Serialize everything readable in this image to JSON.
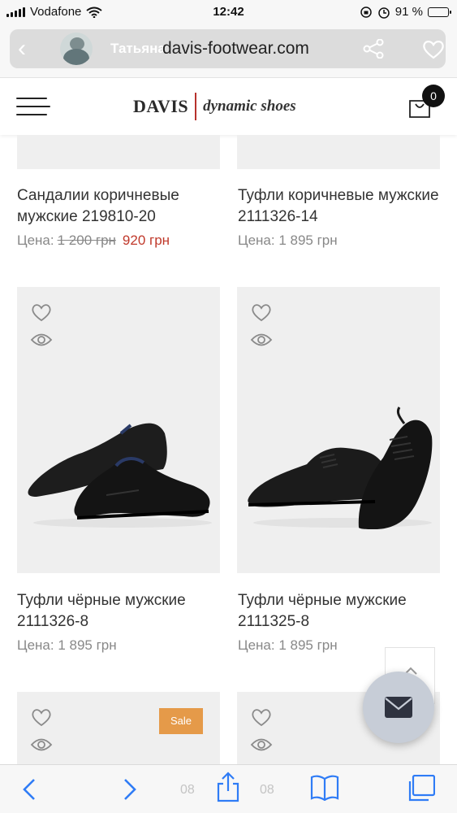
{
  "status_bar": {
    "carrier": "Vodafone",
    "time": "12:42",
    "battery": "91 %",
    "battery_level": 0.91
  },
  "browser": {
    "user_name": "Татьяна",
    "url": "davis-footwear.com"
  },
  "site": {
    "brand": "DAVIS",
    "tagline": "dynamic shoes",
    "cart_count": "0"
  },
  "products": [
    {
      "name": "Сандалии коричневые мужские 219810-20",
      "price_label": "Цена:",
      "old_price": "1 200 грн",
      "price": "920 грн"
    },
    {
      "name": "Туфли коричневые мужские 2111326-14",
      "price_label": "Цена:",
      "price": "1 895 грн"
    },
    {
      "name": "Туфли чёрные мужские 2111326-8",
      "price_label": "Цена:",
      "price": "1 895 грн"
    },
    {
      "name": "Туфли чёрные мужские 2111325-8",
      "price_label": "Цена:",
      "price": "1 895 грн"
    },
    {
      "badge": "Sale"
    }
  ],
  "toolbar": {
    "ghost_left": "08",
    "ghost_right": "08"
  },
  "colors": {
    "accent_price": "#c0392b",
    "sale_badge": "#e59a49",
    "logo_separator": "#b7312c",
    "ios_blue": "#2f7cf6"
  }
}
